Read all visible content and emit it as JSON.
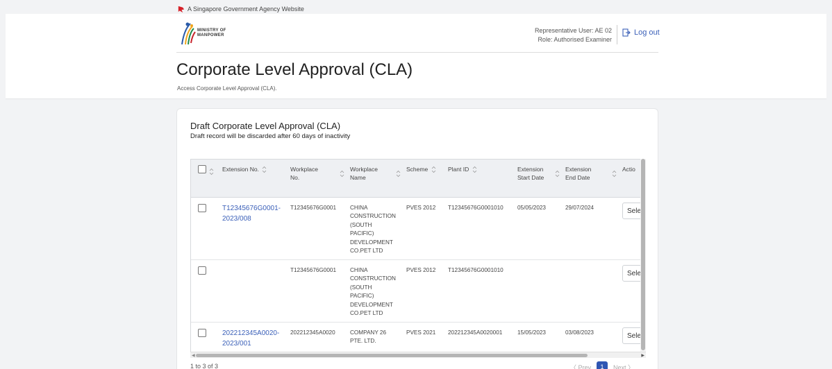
{
  "gov_bar": {
    "text": "A Singapore Government Agency Website",
    "icon": "lion-head-icon"
  },
  "header": {
    "logo_line1": "MINISTRY OF",
    "logo_line2": "MANPOWER",
    "rep_user": "Representative User: AE 02",
    "role": "Role: Authorised Examiner",
    "logout_label": "Log out",
    "title": "Corporate Level Approval (CLA)",
    "subtitle": "Access Corporate Level Approval (CLA)."
  },
  "card": {
    "title": "Draft Corporate Level Approval (CLA)",
    "subtitle": "Draft record will be discarded after 60 days of inactivity"
  },
  "table": {
    "columns": [
      "Extension No.",
      "Workplace No.",
      "Workplace Name",
      "Scheme",
      "Plant ID",
      "Extension Start Date",
      "Extension End Date",
      "Actio"
    ],
    "rows": [
      {
        "ext_no": "T12345676G0001-2023/008",
        "workplace_no": "T12345676G0001",
        "workplace_name": "CHINA CONSTRUCTION (SOUTH PACIFIC) DEVELOPMENT CO.PET LTD",
        "scheme": "PVES 2012",
        "plant_id": "T12345676G0001010",
        "start": "05/05/2023",
        "end": "29/07/2024",
        "action": "Sele"
      },
      {
        "ext_no": "",
        "workplace_no": "T12345676G0001",
        "workplace_name": "CHINA CONSTRUCTION (SOUTH PACIFIC) DEVELOPMENT CO.PET LTD",
        "scheme": "PVES 2012",
        "plant_id": "T12345676G0001010",
        "start": "",
        "end": "",
        "action": "Sele"
      },
      {
        "ext_no": "202212345A0020-2023/001",
        "workplace_no": "202212345A0020",
        "workplace_name": "COMPANY 26 PTE. LTD.",
        "scheme": "PVES 2021",
        "plant_id": "202212345A0020001",
        "start": "15/05/2023",
        "end": "03/08/2023",
        "action": "Sele"
      }
    ]
  },
  "pagination": {
    "count": "1 to 3 of 3",
    "prev": "〈 Prev",
    "page": "1",
    "next": "Next 〉"
  },
  "colors": {
    "accent": "#2f56b3",
    "link": "#3a5fb8"
  }
}
